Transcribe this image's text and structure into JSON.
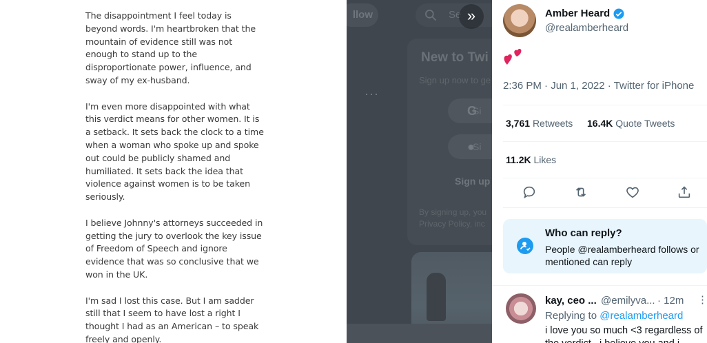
{
  "statement": {
    "paragraphs": [
      "The disappointment I feel today is beyond words. I'm heartbroken that the mountain of evidence still was not enough to stand up to the disproportionate power, influence, and sway of my ex-husband.",
      "I'm even more disappointed with what this verdict means for other women. It is a setback. It sets back the clock to a time when a woman who spoke up and spoke out could be publicly shamed and humiliated. It sets back the idea that violence against women is to be taken seriously.",
      "I believe Johnny's attorneys succeeded in getting the jury to overlook the key issue of Freedom of Speech and ignore evidence that was so conclusive that we won in the UK.",
      "I'm sad I lost this case. But I am sadder still that I seem to have lost a right I thought I had as an American – to speak freely and openly."
    ]
  },
  "backdrop": {
    "follow_label": "llow",
    "search_placeholder": "Se",
    "new_to_twitter": "New to Twi",
    "signup_sub": "Sign up now to ge",
    "google_label": "Si",
    "apple_label": "Si",
    "signup_label": "Sign up",
    "terms_text": "By signing up, you Privacy Policy, inc"
  },
  "tweet": {
    "author_name": "Amber Heard",
    "author_handle": "@realamberheard",
    "body": "❤️‍🔥",
    "timestamp": "2:36 PM · Jun 1, 2022 · Twitter for iPhone",
    "retweets_count": "3,761",
    "retweets_label": "Retweets",
    "quotes_count": "16.4K",
    "quotes_label": "Quote Tweets",
    "likes_count": "11.2K",
    "likes_label": "Likes"
  },
  "reply_settings": {
    "title": "Who can reply?",
    "description": "People @realamberheard follows or mentioned can reply"
  },
  "reply": {
    "name": "kay, ceo ...",
    "handle": "@emilyva...",
    "time": "· 12m",
    "replying_prefix": "Replying to",
    "replying_to": "@realamberheard",
    "text_line1": "i love you so much <3 regardless of",
    "text_line2": "the verdict , i believe you and i"
  },
  "colors": {
    "accent": "#1d9bf0",
    "heart": "#e0245e",
    "backdrop": "#3f464d"
  },
  "icons": [
    "chevron-right-double-icon",
    "verified-badge-icon",
    "reply-icon",
    "retweet-icon",
    "like-icon",
    "share-icon",
    "person-check-icon",
    "more-icon",
    "search-icon",
    "google-icon",
    "apple-icon"
  ]
}
